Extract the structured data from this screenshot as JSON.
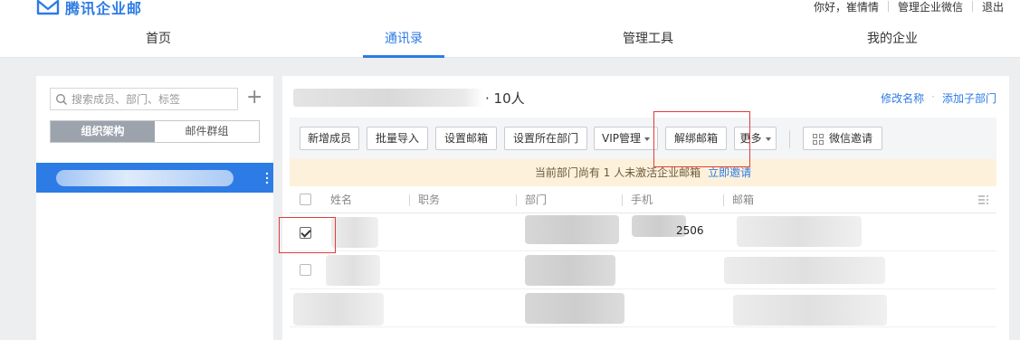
{
  "header": {
    "logo_text": "腾讯企业邮",
    "greeting": "你好，崔情情",
    "admin_link": "管理企业微信",
    "logout": "退出"
  },
  "nav": {
    "tabs": [
      {
        "label": "首页",
        "active": false
      },
      {
        "label": "通讯录",
        "active": true
      },
      {
        "label": "管理工具",
        "active": false
      },
      {
        "label": "我的企业",
        "active": false
      }
    ]
  },
  "sidebar": {
    "search_placeholder": "搜索成员、部门、标签",
    "segment": {
      "active": "组织架构",
      "inactive": "邮件群组"
    }
  },
  "main": {
    "member_count": "· 10人",
    "links": {
      "rename": "修改名称",
      "add_sub": "添加子部门"
    },
    "toolbar": {
      "add_member": "新增成员",
      "batch_import": "批量导入",
      "set_mailbox": "设置邮箱",
      "set_dept": "设置所在部门",
      "vip": "VIP管理",
      "unbind": "解绑邮箱",
      "more": "更多",
      "wechat_invite": "微信邀请"
    },
    "notice": {
      "text": "当前部门尚有 1 人未激活企业邮箱",
      "link": "立即邀请"
    },
    "table": {
      "headers": [
        "姓名",
        "职务",
        "部门",
        "手机",
        "邮箱"
      ],
      "rows": [
        {
          "checked": true,
          "phone_suffix": "2506"
        },
        {
          "checked": false,
          "phone_suffix": ""
        },
        {
          "checked": false,
          "phone_suffix": ""
        }
      ]
    }
  },
  "colors": {
    "accent": "#2d7be5",
    "highlight_box": "#e23b3b",
    "notice_bg": "#fdf1dc"
  }
}
